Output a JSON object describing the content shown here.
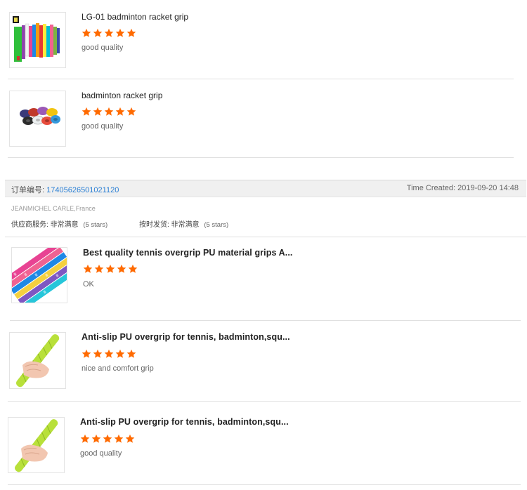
{
  "items_top": [
    {
      "title": "LG-01 badminton racket grip",
      "rating": 5,
      "comment": "good quality",
      "image_icon": "grip-tapes-package-icon"
    },
    {
      "title": "badminton racket grip",
      "rating": 5,
      "comment": "good quality",
      "image_icon": "grip-rolls-icon"
    }
  ],
  "order": {
    "label": "订单编号:",
    "number": "17405626501021120",
    "time_created": "Time Created: 2019-09-20 14:48",
    "buyer": "JEANMICHEL CARLE,France",
    "supplier_service_label": "供应商服务:",
    "supplier_service_value": "非常满意",
    "supplier_service_stars": "(5 stars)",
    "shipping_label": "按时发货:",
    "shipping_value": "非常满意",
    "shipping_stars": "(5 stars)"
  },
  "items_order": [
    {
      "title": "Best quality tennis overgrip PU material grips A...",
      "rating": 5,
      "comment": "OK",
      "image_icon": "colorful-overgrips-icon"
    },
    {
      "title": "Anti-slip PU overgrip for tennis, badminton,squ...",
      "rating": 5,
      "comment": "nice and comfort grip",
      "image_icon": "green-grip-hand-icon"
    },
    {
      "title": "Anti-slip PU overgrip for tennis, badminton,squ...",
      "rating": 5,
      "comment": "good quality",
      "image_icon": "green-grip-hand-icon"
    }
  ],
  "colors": {
    "star": "#ff6a00",
    "order_number": "#2a7fd4"
  }
}
